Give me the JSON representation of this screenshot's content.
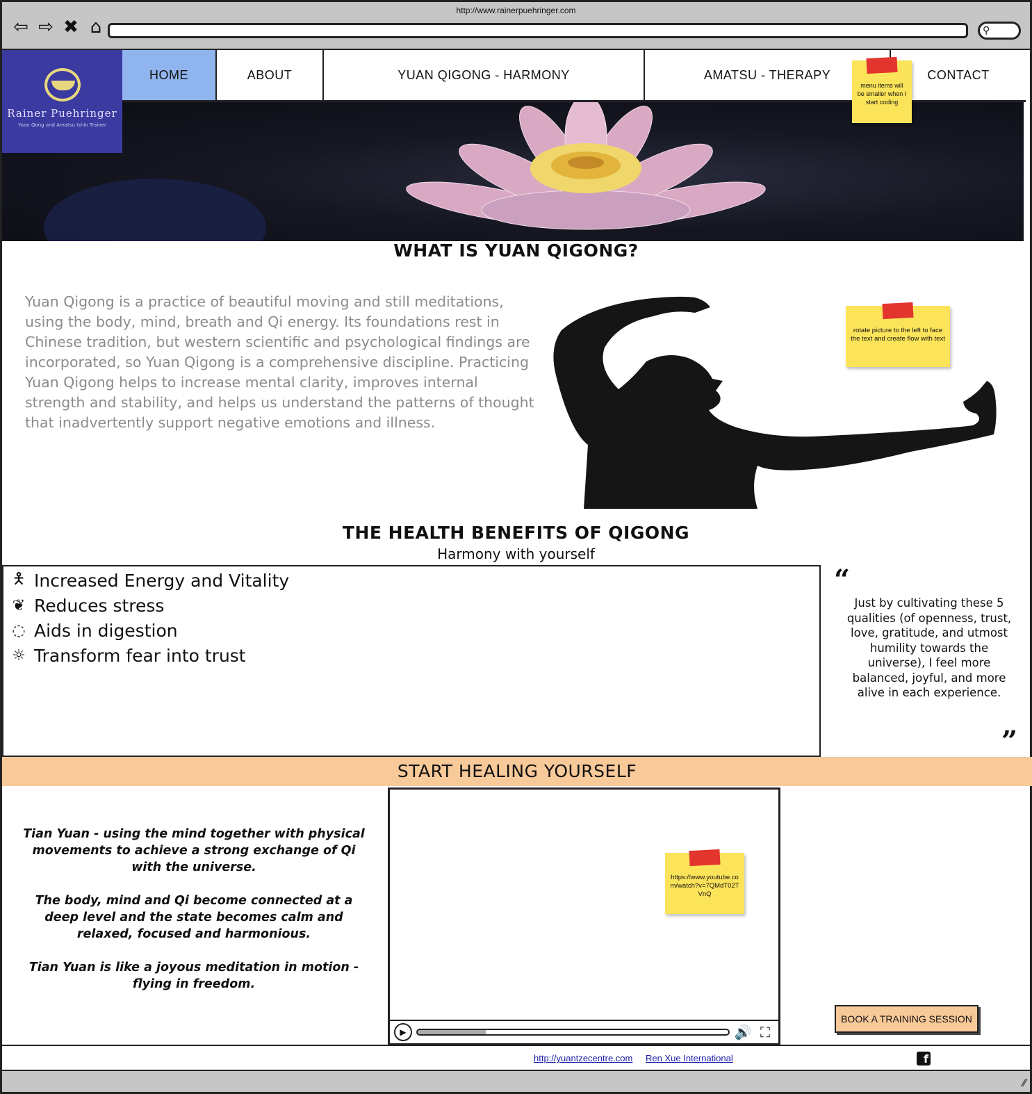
{
  "browser": {
    "url": "http://www.rainerpuehringer.com",
    "search_icon": "search-icon"
  },
  "logo": {
    "name": "Rainer Puehringer",
    "tagline": "Yuan Qong and Amatsu Ishin Trainer",
    "color": "#3a3aa0"
  },
  "nav": {
    "items": [
      {
        "label": "HOME",
        "active": true
      },
      {
        "label": "ABOUT"
      },
      {
        "label": "YUAN QIGONG - HARMONY"
      },
      {
        "label": "AMATSU - THERAPY"
      },
      {
        "label": "CONTACT"
      }
    ],
    "active_color": "#8fb4ee"
  },
  "notes": {
    "menu": "menu items will be smaller when I start coding",
    "picture": "rotate picture to the left to face the text and create flow with text",
    "video": "https://www.youtube.com/watch?v=7QMdT02TVnQ"
  },
  "what": {
    "heading": "WHAT IS YUAN QIGONG?",
    "text": "Yuan Qigong is a practice of beautiful moving and still meditations, using the body, mind, breath and Qi energy. Its foundations rest in Chinese tradition, but western scientific and psychological findings are incorporated, so Yuan Qigong is a comprehensive discipline. Practicing Yuan Qigong helps to increase mental clarity, improves internal strength and stability, and helps us understand the patterns of thought that inadvertently support negative emotions and illness."
  },
  "benefits": {
    "heading": "THE HEALTH BENEFITS OF QIGONG",
    "subheading": "Harmony with yourself",
    "items": [
      {
        "label": "Increased Energy and Vitality",
        "icon": "person-icon"
      },
      {
        "label": "Reduces stress",
        "icon": "leaf-icon"
      },
      {
        "label": "Aids in digestion",
        "icon": "stomach-icon"
      },
      {
        "label": "Transform fear into trust",
        "icon": "sun-icon"
      }
    ],
    "quote": "Just by cultivating these 5 qualities (of openness, trust, love, gratitude, and utmost humility towards the universe), I feel more balanced, joyful, and more alive in each experience."
  },
  "healing": {
    "heading": "START HEALING YOURSELF",
    "band_color": "#f8c999",
    "paragraphs": [
      "Tian Yuan - using the mind together with physical movements to achieve a strong exchange of Qi with the universe.",
      "The body, mind and Qi become connected at a deep level and the state becomes calm and relaxed, focused and harmonious.",
      "Tian Yuan is like a joyous meditation in motion - flying in freedom."
    ],
    "video_progress": 0.22,
    "book_button": "BOOK A TRAINING SESSION"
  },
  "footer": {
    "link1": "http://yuantzecentre.com",
    "link2": "Ren Xue International",
    "social_icon": "facebook-icon"
  }
}
